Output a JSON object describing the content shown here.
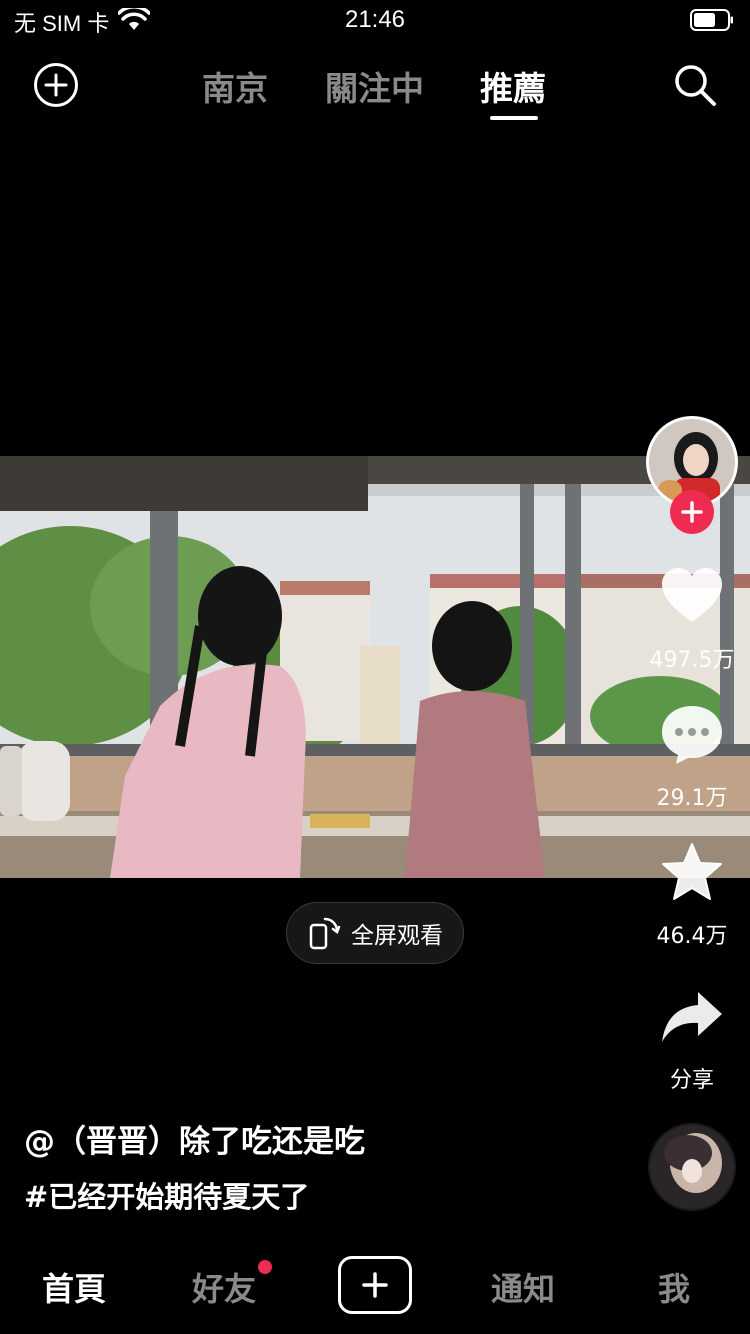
{
  "status_bar": {
    "carrier": "无 SIM 卡",
    "time": "21:46",
    "icons": [
      "wifi-icon",
      "battery-icon"
    ]
  },
  "top_nav": {
    "tabs": [
      {
        "label": "南京",
        "active": false
      },
      {
        "label": "關注中",
        "active": false
      },
      {
        "label": "推薦",
        "active": true
      }
    ],
    "left_icon": "add-circle-icon",
    "right_icon": "search-icon"
  },
  "video": {
    "fullscreen_label": "全屏观看"
  },
  "side_actions": {
    "like_count": "497.5万",
    "comment_count": "29.1万",
    "favorite_count": "46.4万",
    "share_label": "分享"
  },
  "caption": {
    "author": "@（晋晋）除了吃还是吃",
    "text": "#已经开始期待夏天了"
  },
  "bottom_nav": {
    "items": [
      {
        "label": "首頁",
        "active": true
      },
      {
        "label": "好友",
        "active": false,
        "badge": true
      },
      {
        "label": "通知",
        "active": false
      },
      {
        "label": "我",
        "active": false
      }
    ],
    "create_icon": "plus-square-icon"
  },
  "colors": {
    "background": "#000000",
    "accent": "#ee2b51",
    "inactive_text": "#8a8a8a"
  }
}
